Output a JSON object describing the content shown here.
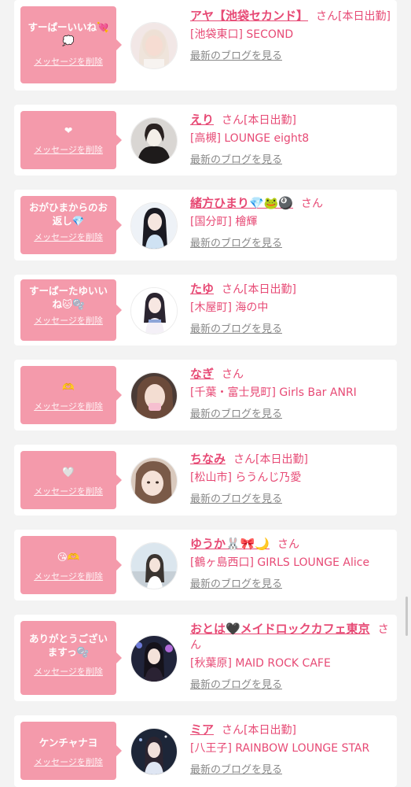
{
  "labels": {
    "delete": "メッセージを削除",
    "blog": "最新のブログを見る"
  },
  "colors": {
    "bubble": "#f49aab",
    "accent": "#e74a75",
    "link_gray": "#888888",
    "background": "#f3f3f3"
  },
  "items": [
    {
      "message": "すーぱーいいね💘💭",
      "name": "アヤ【池袋セカンド】",
      "suffix": "さん[本日出勤]",
      "shop": "[池袋東口] SECOND"
    },
    {
      "message": "❤",
      "name": "えり",
      "suffix": "さん[本日出勤]",
      "shop": "[高槻] LOUNGE eight8"
    },
    {
      "message": "おがひまからのお返し💎",
      "name": "緒方ひまり💎🐸🎱",
      "suffix": "さん",
      "shop": "[国分町] 檜輝"
    },
    {
      "message": "すーぱーたゆいいね🐱🫧",
      "name": "たゆ",
      "suffix": "さん[本日出勤]",
      "shop": "[木屋町] 海の中"
    },
    {
      "message": "🫶",
      "name": "なぎ",
      "suffix": "さん",
      "shop": "[千葉・富士見町] Girls Bar ANRI"
    },
    {
      "message": "🤍",
      "name": "ちなみ",
      "suffix": "さん[本日出勤]",
      "shop": "[松山市] らうんじ乃愛"
    },
    {
      "message": "😘🫶",
      "name": "ゆうか🐰🎀🌙",
      "suffix": "さん",
      "shop": "[鶴ヶ島西口] GIRLS LOUNGE Alice"
    },
    {
      "message": "ありがとうございますっ🫧",
      "name": "おとは🖤メイドロックカフェ東京",
      "suffix": "さん",
      "shop": "[秋葉原] MAID ROCK CAFE"
    },
    {
      "message": "ケンチャナヨ",
      "name": "ミア",
      "suffix": "さん[本日出勤]",
      "shop": "[八王子] RAINBOW LOUNGE STAR"
    }
  ]
}
